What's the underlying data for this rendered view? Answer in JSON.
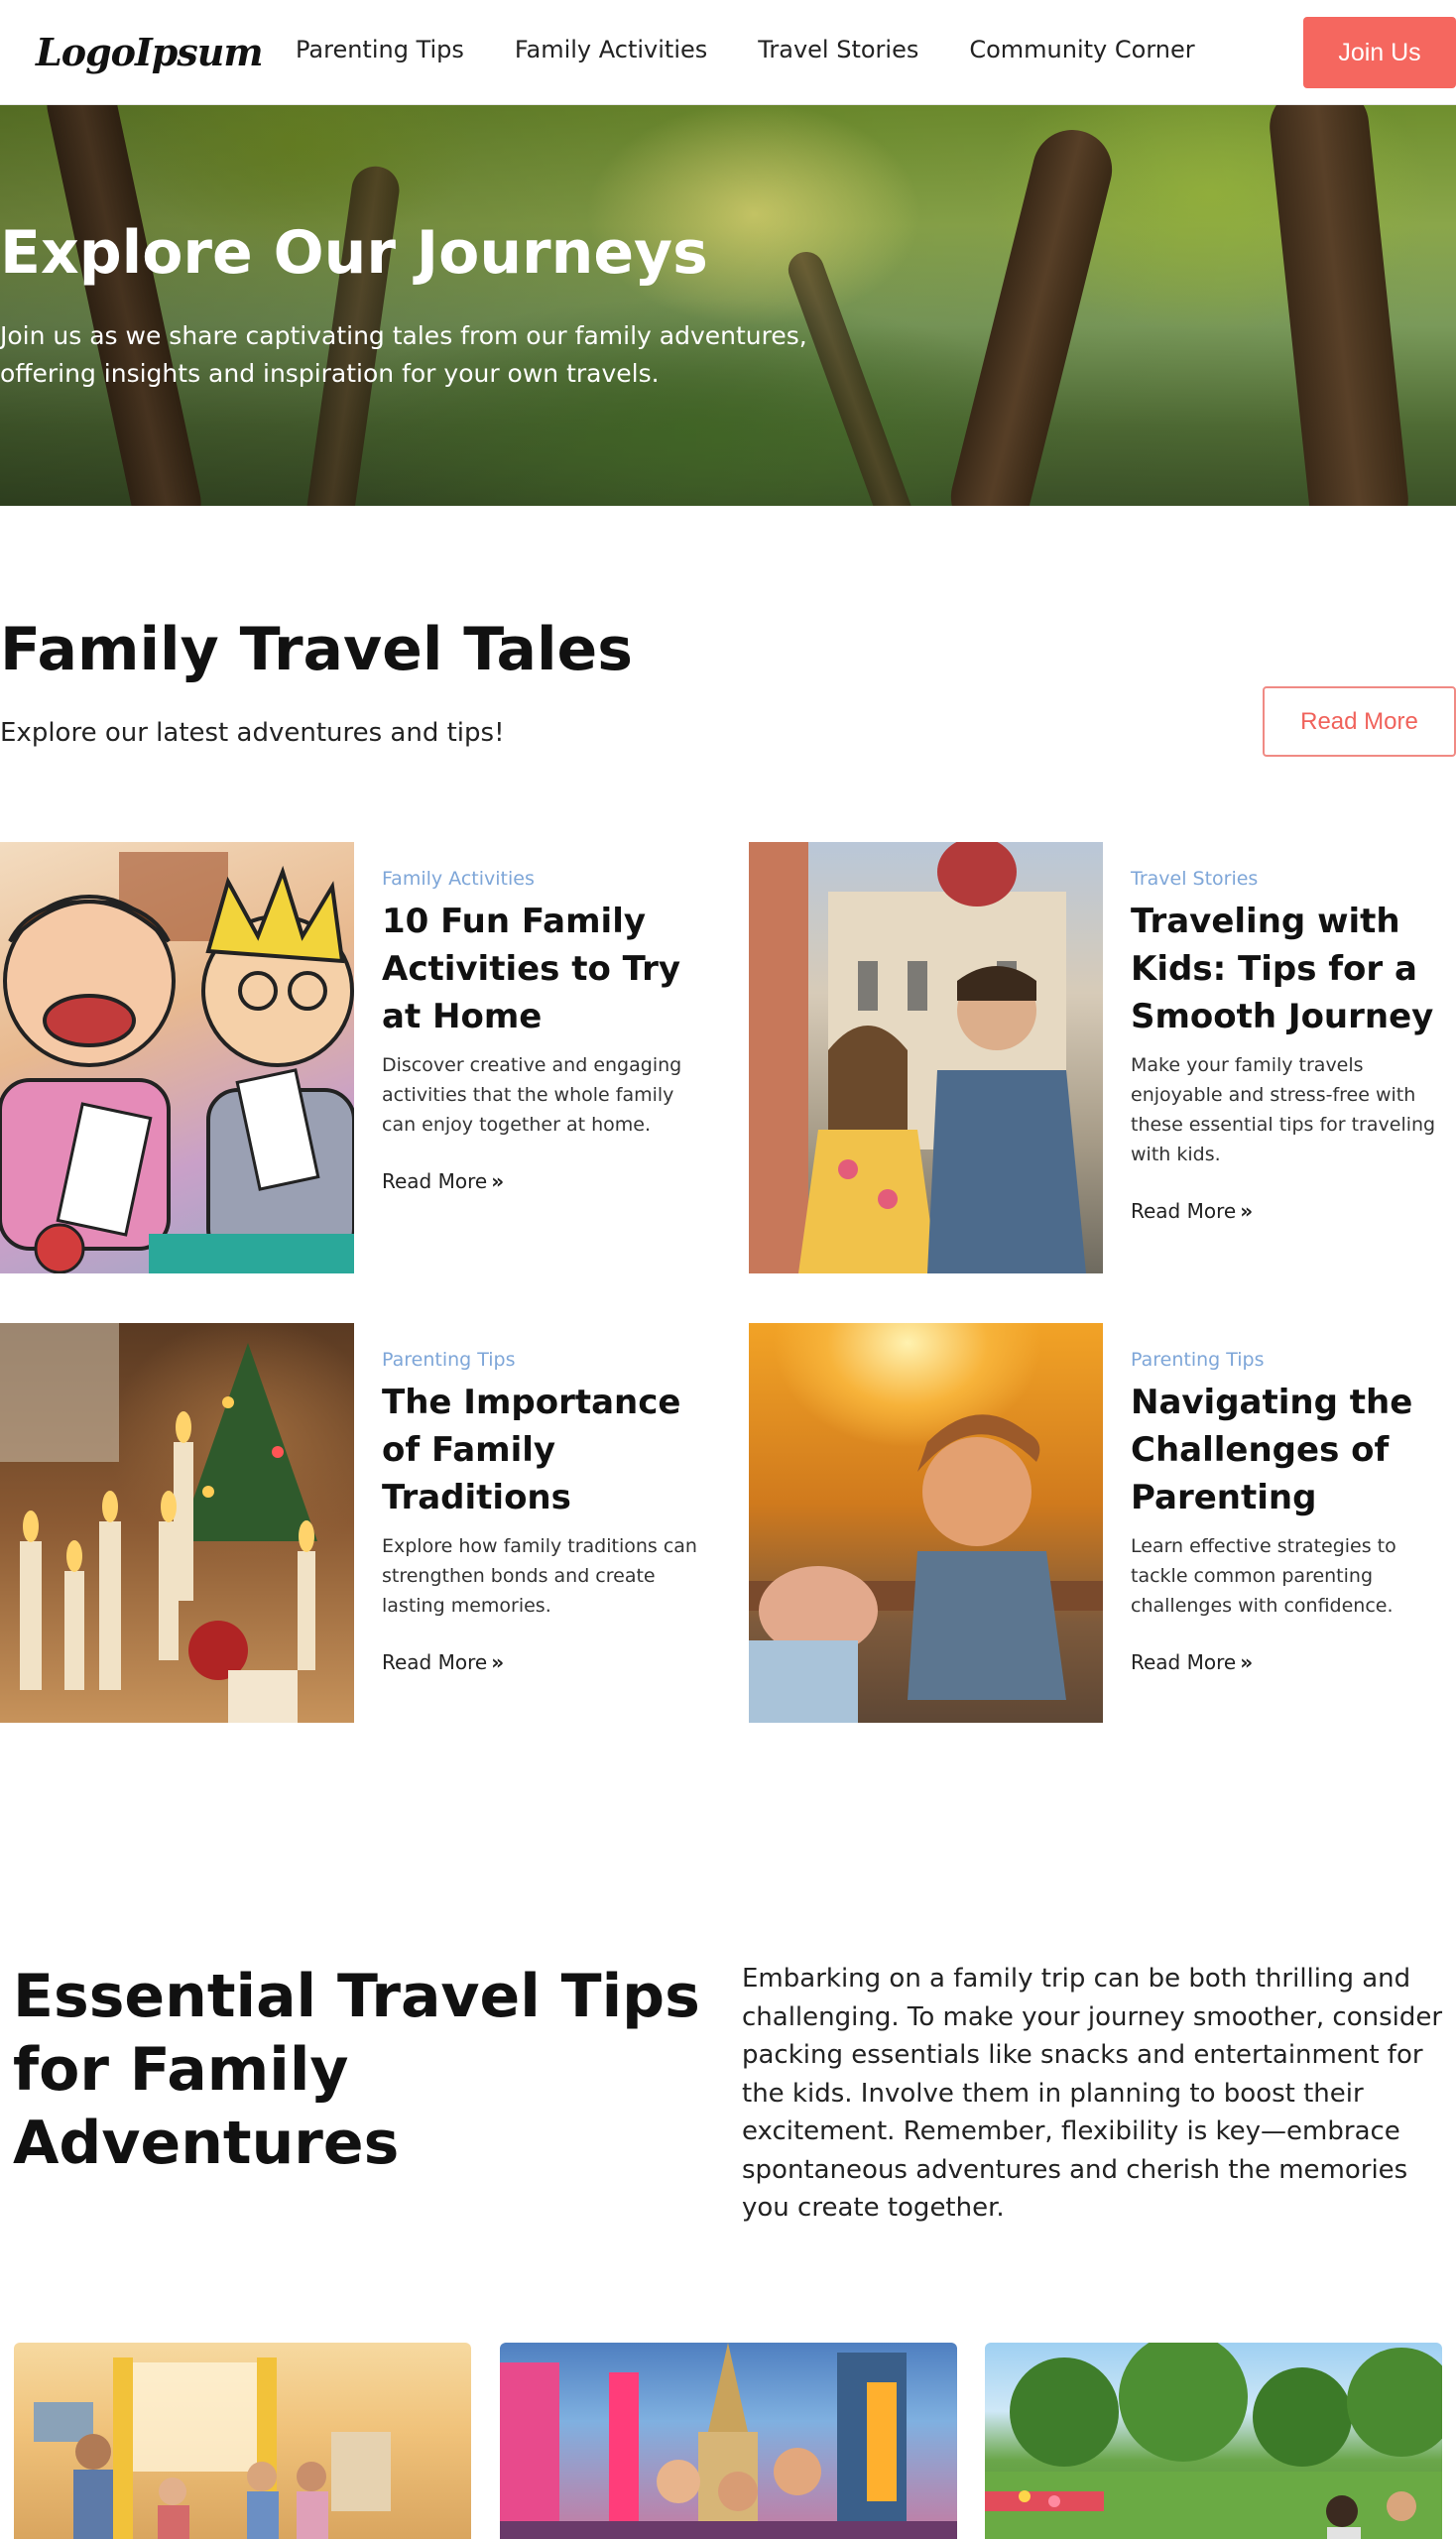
{
  "header": {
    "logo": "LogoIpsum",
    "nav": [
      "Parenting Tips",
      "Family Activities",
      "Travel Stories",
      "Community Corner"
    ],
    "join_label": "Join Us"
  },
  "hero": {
    "title": "Explore Our Journeys",
    "subtitle": "Join us as we share captivating tales from our family adventures, offering insights and inspiration for your own travels."
  },
  "tales": {
    "title": "Family Travel Tales",
    "subtitle": "Explore our latest adventures and tips!",
    "read_more_label": "Read More",
    "cards": [
      {
        "category": "Family Activities",
        "title": "10 Fun Family Activities to Try at Home",
        "description": "Discover creative and engaging activities that the whole family can enjoy together at home.",
        "link": "Read More",
        "image_icon": "family-game-illustration"
      },
      {
        "category": "Travel Stories",
        "title": "Traveling with Kids: Tips for a Smooth Journey",
        "description": "Make your family travels enjoyable and stress-free with these essential tips for traveling with kids.",
        "link": "Read More",
        "image_icon": "couple-city-photo"
      },
      {
        "category": "Parenting Tips",
        "title": "The Importance of Family Traditions",
        "description": "Explore how family traditions can strengthen bonds and create lasting memories.",
        "link": "Read More",
        "image_icon": "candles-photo"
      },
      {
        "category": "Parenting Tips",
        "title": "Navigating the Challenges of Parenting",
        "description": "Learn effective strategies to tackle common parenting challenges with confidence.",
        "link": "Read More",
        "image_icon": "child-sunset-photo"
      }
    ]
  },
  "tips": {
    "title": "Essential Travel Tips for Family Adventures",
    "text": "Embarking on a family trip can be both thrilling and challenging. To make your journey smoother, consider packing essentials like snacks and entertainment for the kids. Involve them in planning to boost their excitement. Remember, flexibility is key—embrace spontaneous adventures and cherish the memories you create together."
  },
  "colors": {
    "accent": "#f5675f",
    "category": "#7ea6d8",
    "text": "#111111"
  }
}
